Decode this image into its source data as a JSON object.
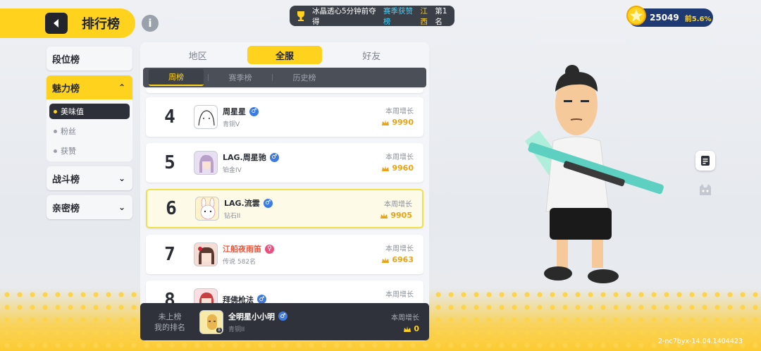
{
  "header": {
    "title": "排行榜",
    "info_icon": "info-icon",
    "back_icon": "back-arrow-icon"
  },
  "notice": {
    "part1": "冰晶透心5分钟前夺得",
    "part2": "赛季获赞榜",
    "part3": "江西",
    "part4": "第1名"
  },
  "currency": {
    "value": "25049",
    "percent": "前5.6%"
  },
  "sidebar": {
    "items": [
      {
        "label": "段位榜"
      },
      {
        "label": "魅力榜",
        "chev": "⌃"
      },
      {
        "label": "战斗榜",
        "chev": "⌄"
      },
      {
        "label": "亲密榜",
        "chev": "⌄"
      }
    ],
    "sub_items": [
      {
        "label": "美味值"
      },
      {
        "label": "粉丝"
      },
      {
        "label": "获赞"
      }
    ]
  },
  "tabs": [
    {
      "label": "地区"
    },
    {
      "label": "全服"
    },
    {
      "label": "好友"
    }
  ],
  "subtabs": [
    {
      "label": "周榜"
    },
    {
      "label": "赛季榜"
    },
    {
      "label": "历史榜"
    }
  ],
  "rows": [
    {
      "rank": "4",
      "name": "周星星",
      "tier": "青铜V",
      "gender": "♂",
      "growth_label": "本周增长",
      "growth": "9990"
    },
    {
      "rank": "5",
      "name": "LAG.周星驰",
      "tier": "铂金IV",
      "gender": "♂",
      "growth_label": "本周增长",
      "growth": "9960"
    },
    {
      "rank": "6",
      "name": "LAG.流雲",
      "tier": "钻石II",
      "gender": "♂",
      "growth_label": "本周增长",
      "growth": "9905"
    },
    {
      "rank": "7",
      "name": "江船夜雨笛",
      "tier": "传说 582名",
      "gender": "♀",
      "growth_label": "本周增长",
      "growth": "6963"
    },
    {
      "rank": "8",
      "name": "拜佛枪法",
      "tier": "",
      "gender": "♂",
      "growth_label": "本周增长",
      "growth": ""
    }
  ],
  "my_rank": {
    "status": "未上榜",
    "label": "我的排名",
    "name": "全明星小小明",
    "tier": "青铜II",
    "gender": "♂",
    "growth_label": "本周增长",
    "growth": "0"
  },
  "version": "2-nc7byx-14.04.1404423",
  "colors": {
    "accent": "#ffd21e",
    "dark": "#2f323a",
    "male": "#3d7be0",
    "female": "#ee4d7e",
    "growth": "#e8a418"
  }
}
